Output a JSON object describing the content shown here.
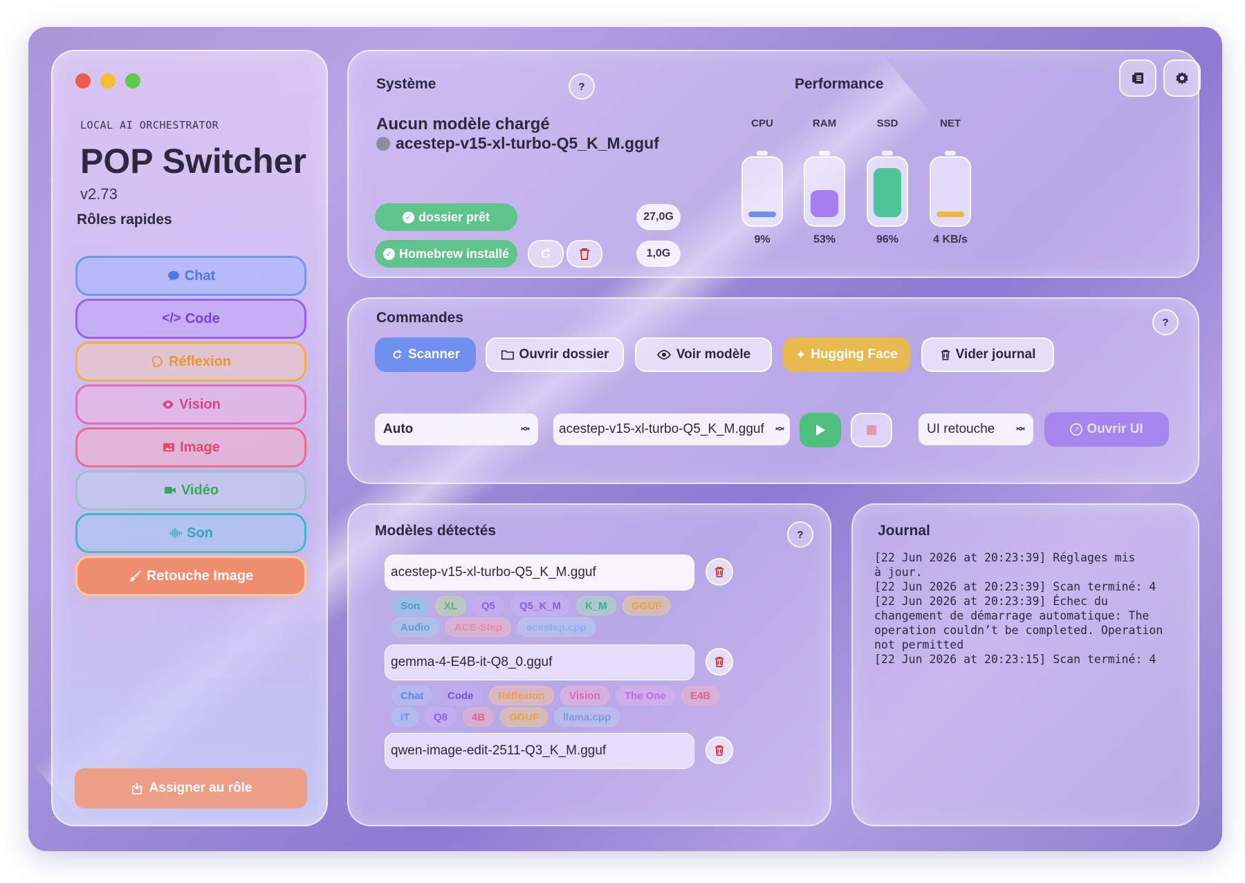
{
  "app": {
    "subtitle": "LOCAL AI ORCHESTRATOR",
    "title": "POP Switcher",
    "version": "v2.73"
  },
  "sidebar": {
    "roles_heading": "Rôles rapides",
    "roles": [
      {
        "label": "Chat",
        "icon": "chat-bubble-icon",
        "color": "#5b8df0"
      },
      {
        "label": "Code",
        "icon": "code-icon",
        "color": "#8a4fea"
      },
      {
        "label": "Réflexion",
        "icon": "brain-icon",
        "color": "#f0a830"
      },
      {
        "label": "Vision",
        "icon": "eye-icon",
        "color": "#e0509a"
      },
      {
        "label": "Image",
        "icon": "image-icon",
        "color": "#e84f78"
      },
      {
        "label": "Vidéo",
        "icon": "video-camera-icon",
        "color": "#3fae6a"
      },
      {
        "label": "Son",
        "icon": "waveform-icon",
        "color": "#2ab4c8"
      },
      {
        "label": "Retouche Image",
        "icon": "brush-icon",
        "color": "#ee8c6c"
      }
    ],
    "assign_label": "Assigner au rôle"
  },
  "system": {
    "heading": "Système",
    "status": "Aucun modèle chargé",
    "model": "acestep-v15-xl-turbo-Q5_K_M.gguf",
    "folder_ready": "dossier prêt",
    "folder_size": "27,0G",
    "homebrew": "Homebrew installé",
    "homebrew_size": "1,0G"
  },
  "performance": {
    "heading": "Performance",
    "meters": [
      {
        "label": "CPU",
        "value": "9%",
        "level": 0.09,
        "color": "#6f8ff2"
      },
      {
        "label": "RAM",
        "value": "53%",
        "level": 0.53,
        "color": "#a57ef0"
      },
      {
        "label": "SSD",
        "value": "96%",
        "level": 0.96,
        "color": "#4dc596"
      },
      {
        "label": "NET",
        "value": "4 KB/s",
        "level": 0.08,
        "color": "#f2b540"
      }
    ]
  },
  "commands": {
    "heading": "Commandes",
    "scan": "Scanner",
    "open_folder": "Ouvrir dossier",
    "view_model": "Voir modèle",
    "hugging_face": "Hugging Face",
    "clear_log": "Vider journal",
    "mode_select": "Auto",
    "model_select": "acestep-v15-xl-turbo-Q5_K_M.gguf",
    "ui_select": "UI retouche",
    "open_ui": "Ouvrir UI"
  },
  "models": {
    "heading": "Modèles détectés",
    "items": [
      {
        "name": "acestep-v15-xl-turbo-Q5_K_M.gguf",
        "tags": [
          [
            "Son",
            "XL",
            "Q5",
            "Q5_K_M",
            "K_M",
            "GGUF"
          ],
          [
            "Audio",
            "ACE-Step",
            "acestep.cpp"
          ]
        ]
      },
      {
        "name": "gemma-4-E4B-it-Q8_0.gguf",
        "tags": [
          [
            "Chat",
            "Code",
            "Réflexion",
            "Vision",
            "The One",
            "E4B"
          ],
          [
            "IT",
            "Q8",
            "4B",
            "GGUF",
            "llama.cpp"
          ]
        ]
      },
      {
        "name": "qwen-image-edit-2511-Q3_K_M.gguf",
        "tags": []
      }
    ]
  },
  "journal": {
    "heading": "Journal",
    "lines": "[22 Jun 2026 at 20:23:39] Réglages mis\nà jour.\n[22 Jun 2026 at 20:23:39] Scan terminé: 4\n[22 Jun 2026 at 20:23:39] Échec du\nchangement de démarrage automatique: The\noperation couldn’t be completed. Operation\nnot permitted\n[22 Jun 2026 at 20:23:15] Scan terminé: 4"
  }
}
